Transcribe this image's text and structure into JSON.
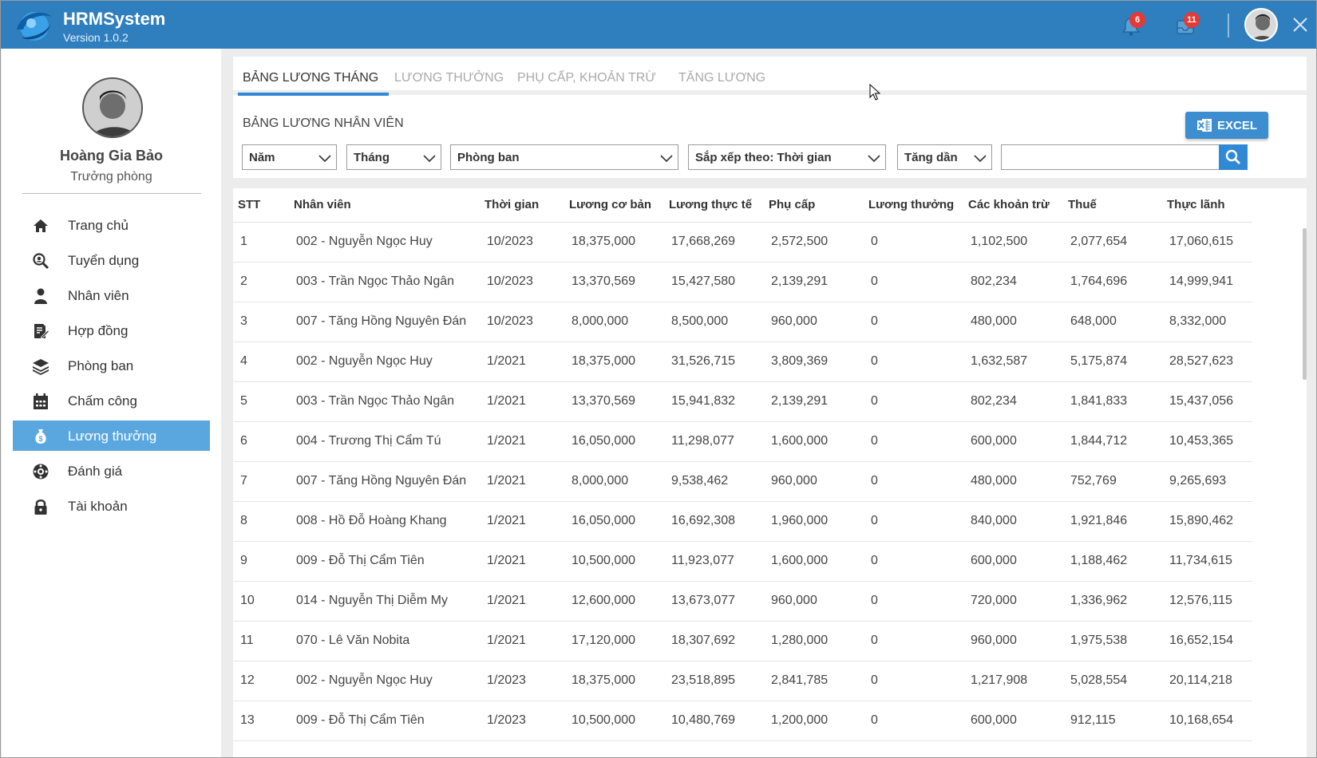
{
  "app": {
    "title": "HRMSystem",
    "version": "Version 1.0.2"
  },
  "header": {
    "notifications_count": "6",
    "messages_count": "11"
  },
  "user": {
    "name": "Hoàng Gia Bảo",
    "role": "Trưởng phòng"
  },
  "sidebar": {
    "items": [
      {
        "label": "Trang chủ",
        "icon": "home-icon"
      },
      {
        "label": "Tuyển dụng",
        "icon": "recruit-search-icon"
      },
      {
        "label": "Nhân viên",
        "icon": "person-icon"
      },
      {
        "label": "Hợp đồng",
        "icon": "contract-icon"
      },
      {
        "label": "Phòng ban",
        "icon": "layers-icon"
      },
      {
        "label": "Chấm công",
        "icon": "calendar-icon"
      },
      {
        "label": "Lương thưởng",
        "icon": "money-bag-icon"
      },
      {
        "label": "Đánh giá",
        "icon": "review-icon"
      },
      {
        "label": "Tài khoản",
        "icon": "lock-icon"
      }
    ],
    "active_index": 6
  },
  "tabs": [
    "BẢNG LƯƠNG THÁNG",
    "LƯƠNG THƯỞNG",
    "PHỤ CẤP, KHOẢN TRỪ",
    "TĂNG LƯƠNG"
  ],
  "section_title": "BẢNG LƯƠNG NHÂN VIÊN",
  "excel_label": "EXCEL",
  "filters": {
    "year": "Năm",
    "month": "Tháng",
    "department": "Phòng ban",
    "sort_by": "Sắp xếp theo: Thời gian",
    "order": "Tăng dần",
    "search_value": ""
  },
  "colors": {
    "titlebar": "#2f7fbf",
    "active_nav": "#5aa7e0",
    "accent": "#2f89d4",
    "badge": "#e53935"
  },
  "table": {
    "columns": [
      "STT",
      "Nhân viên",
      "Thời gian",
      "Lương cơ bản",
      "Lương thực tế",
      "Phụ cấp",
      "Lương thưởng",
      "Các khoản trừ",
      "Thuế",
      "Thực lãnh"
    ],
    "rows": [
      [
        "1",
        "002 - Nguyễn Ngọc Huy",
        "10/2023",
        "18,375,000",
        "17,668,269",
        "2,572,500",
        "0",
        "1,102,500",
        "2,077,654",
        "17,060,615"
      ],
      [
        "2",
        "003 - Trần Ngọc Thảo Ngân",
        "10/2023",
        "13,370,569",
        "15,427,580",
        "2,139,291",
        "0",
        "802,234",
        "1,764,696",
        "14,999,941"
      ],
      [
        "3",
        "007 - Tăng Hồng Nguyên Đán",
        "10/2023",
        "8,000,000",
        "8,500,000",
        "960,000",
        "0",
        "480,000",
        "648,000",
        "8,332,000"
      ],
      [
        "4",
        "002 - Nguyễn Ngọc Huy",
        "1/2021",
        "18,375,000",
        "31,526,715",
        "3,809,369",
        "0",
        "1,632,587",
        "5,175,874",
        "28,527,623"
      ],
      [
        "5",
        "003 - Trần Ngọc Thảo Ngân",
        "1/2021",
        "13,370,569",
        "15,941,832",
        "2,139,291",
        "0",
        "802,234",
        "1,841,833",
        "15,437,056"
      ],
      [
        "6",
        "004 - Trương Thị Cẩm Tú",
        "1/2021",
        "16,050,000",
        "11,298,077",
        "1,600,000",
        "0",
        "600,000",
        "1,844,712",
        "10,453,365"
      ],
      [
        "7",
        "007 - Tăng Hồng Nguyên Đán",
        "1/2021",
        "8,000,000",
        "9,538,462",
        "960,000",
        "0",
        "480,000",
        "752,769",
        "9,265,693"
      ],
      [
        "8",
        "008 - Hồ Đỗ Hoàng Khang",
        "1/2021",
        "16,050,000",
        "16,692,308",
        "1,960,000",
        "0",
        "840,000",
        "1,921,846",
        "15,890,462"
      ],
      [
        "9",
        "009 - Đỗ Thị Cẩm Tiên",
        "1/2021",
        "10,500,000",
        "11,923,077",
        "1,600,000",
        "0",
        "600,000",
        "1,188,462",
        "11,734,615"
      ],
      [
        "10",
        "014 - Nguyễn Thị Diễm My",
        "1/2021",
        "12,600,000",
        "13,673,077",
        "960,000",
        "0",
        "720,000",
        "1,336,962",
        "12,576,115"
      ],
      [
        "11",
        "070 - Lê Văn Nobita",
        "1/2021",
        "17,120,000",
        "18,307,692",
        "1,280,000",
        "0",
        "960,000",
        "1,975,538",
        "16,652,154"
      ],
      [
        "12",
        "002 - Nguyễn Ngọc Huy",
        "1/2023",
        "18,375,000",
        "23,518,895",
        "2,841,785",
        "0",
        "1,217,908",
        "5,028,554",
        "20,114,218"
      ],
      [
        "13",
        "009 - Đỗ Thị Cẩm Tiên",
        "1/2023",
        "10,500,000",
        "10,480,769",
        "1,200,000",
        "0",
        "600,000",
        "912,115",
        "10,168,654"
      ]
    ]
  }
}
